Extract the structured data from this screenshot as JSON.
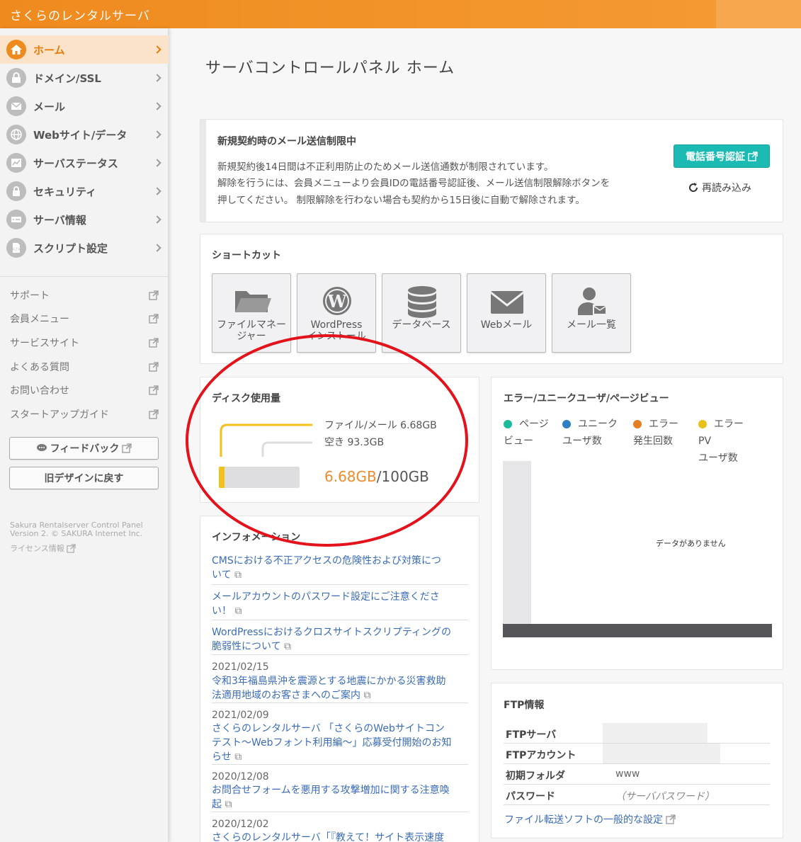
{
  "header": {
    "brand": "さくらのレンタルサーバ"
  },
  "sidebar": {
    "nav": [
      {
        "label": "ホーム",
        "icon": "home-icon",
        "active": true
      },
      {
        "label": "ドメイン/SSL",
        "icon": "domain-icon"
      },
      {
        "label": "メール",
        "icon": "mail-icon"
      },
      {
        "label": "Webサイト/データ",
        "icon": "globe-icon"
      },
      {
        "label": "サーバステータス",
        "icon": "chart-icon"
      },
      {
        "label": "セキュリティ",
        "icon": "lock-icon"
      },
      {
        "label": "サーバ情報",
        "icon": "server-icon"
      },
      {
        "label": "スクリプト設定",
        "icon": "script-icon"
      }
    ],
    "links": [
      "サポート",
      "会員メニュー",
      "サービスサイト",
      "よくある質問",
      "お問い合わせ",
      "スタートアップガイド"
    ],
    "feedback_label": "フィードバック",
    "old_design_label": "旧デザインに戻す",
    "footer_line1": "Sakura Rentalserver Control Panel",
    "footer_line2": "Version 2. © SAKURA Internet Inc.",
    "license_label": "ライセンス情報"
  },
  "main": {
    "title": "サーバコントロールパネル ホーム",
    "notice": {
      "title": "新規契約時のメール送信制限中",
      "line1": "新規契約後14日間は不正利用防止のためメール送信通数が制限されています。",
      "line2": "解除を行うには、会員メニューより会員IDの電話番号認証後、メール送信制限解除ボタンを",
      "line3": "押してください。 制限解除を行わない場合も契約から15日後に自動で解除されます。",
      "tel_button": "電話番号認証",
      "reload_label": "再読み込み"
    },
    "shortcut": {
      "title": "ショートカット",
      "items": [
        {
          "line1": "ファイルマネー",
          "line2": "ジャー",
          "icon": "folder-icon"
        },
        {
          "line1": "WordPress",
          "line2": "インストール",
          "icon": "wordpress-icon"
        },
        {
          "line1": "データベース",
          "line2": "",
          "icon": "database-icon"
        },
        {
          "line1": "Webメール",
          "line2": "",
          "icon": "envelope-icon"
        },
        {
          "line1": "メール一覧",
          "line2": "",
          "icon": "mail-user-icon"
        }
      ]
    },
    "disk": {
      "title": "ディスク使用量",
      "file_mail": "ファイル/メール 6.68GB",
      "free": "空き 93.3GB",
      "used": "6.68GB",
      "total": "/100GB",
      "used_fraction": 0.0668,
      "used_color": "#f2c21b"
    },
    "info": {
      "title": "インフォメーション",
      "items": [
        {
          "date": "",
          "line1": "CMSにおける不正アクセスの危険性および対策につ",
          "line2": "いて"
        },
        {
          "date": "",
          "line1": "メールアカウントのパスワード設定にご注意くださ",
          "line2": "い！"
        },
        {
          "date": "",
          "line1": "WordPressにおけるクロスサイトスクリプティングの",
          "line2": "脆弱性について"
        },
        {
          "date": "2021/02/15",
          "line1": "令和3年福島県沖を震源とする地震にかかる災害救助",
          "line2": "法適用地域のお客さまへのご案内"
        },
        {
          "date": "2021/02/09",
          "line1": "さくらのレンタルサーバ 「さくらのWebサイトコン",
          "line2": "テスト～Webフォント利用編～」応募受付開始のお知",
          "line3": "らせ"
        },
        {
          "date": "2020/12/08",
          "line1": "お問合せフォームを悪用する攻撃増加に関する注意喚",
          "line2": "起"
        },
        {
          "date": "2020/12/02",
          "line1": "さくらのレンタルサーバ「『教えて！サイト表示速度",
          "line2": ""
        }
      ]
    },
    "chart": {
      "title": "エラー/ユニークユーザ/ページビュー",
      "legend": [
        {
          "l1": "ページ",
          "l2": "ビュー",
          "color": "#1abc9c"
        },
        {
          "l1": "ユニーク",
          "l2": "ユーザ数",
          "color": "#2d7fc1"
        },
        {
          "l1": "エラー",
          "l2": "発生回数",
          "color": "#e67e22"
        },
        {
          "l1": "エラーPV",
          "l2": "ユーザ数",
          "color": "#e8c21a"
        }
      ],
      "no_data": "データがありません"
    },
    "ftp": {
      "title": "FTP情報",
      "rows": [
        {
          "key": "FTPサーバ",
          "value": ""
        },
        {
          "key": "FTPアカウント",
          "value": ""
        },
        {
          "key": "初期フォルダ",
          "value": "www"
        },
        {
          "key": "パスワード",
          "value": "（サーバパスワード）"
        }
      ],
      "link": "ファイル転送ソフトの一般的な設定"
    }
  }
}
